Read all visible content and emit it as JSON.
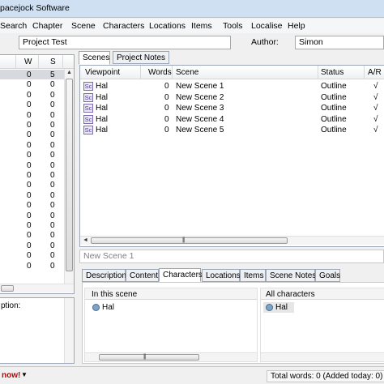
{
  "window": {
    "title": "pacejock Software"
  },
  "menu": [
    "Search",
    "Chapter",
    "Scene",
    "Characters",
    "Locations",
    "Items",
    "Tools",
    "Localise",
    "Help"
  ],
  "project": {
    "name": "Project Test",
    "author_label": "Author:",
    "author": "Simon"
  },
  "chapters": {
    "headers": [
      "W",
      "S"
    ],
    "rows": [
      {
        "w": "0",
        "s": "5"
      },
      {
        "w": "0",
        "s": "0"
      },
      {
        "w": "0",
        "s": "0"
      },
      {
        "w": "0",
        "s": "0"
      },
      {
        "w": "0",
        "s": "0"
      },
      {
        "w": "0",
        "s": "0"
      },
      {
        "w": "0",
        "s": "0"
      },
      {
        "w": "0",
        "s": "0"
      },
      {
        "w": "0",
        "s": "0"
      },
      {
        "w": "0",
        "s": "0"
      },
      {
        "w": "0",
        "s": "0"
      },
      {
        "w": "0",
        "s": "0"
      },
      {
        "w": "0",
        "s": "0"
      },
      {
        "w": "0",
        "s": "0"
      },
      {
        "w": "0",
        "s": "0"
      },
      {
        "w": "0",
        "s": "0"
      },
      {
        "w": "0",
        "s": "0"
      },
      {
        "w": "0",
        "s": "0"
      },
      {
        "w": "0",
        "s": "0"
      },
      {
        "w": "0",
        "s": "0"
      }
    ]
  },
  "description_label": "ption:",
  "scene_tabs": [
    "Scenes",
    "Project Notes"
  ],
  "scenes": {
    "headers": [
      "Viewpoint",
      "Words",
      "Scene",
      "Status",
      "A/R"
    ],
    "icon_text": "Sc",
    "rows": [
      {
        "viewpoint": "Hal",
        "words": "0",
        "scene": "New Scene 1",
        "status": "Outline",
        "ar": "√"
      },
      {
        "viewpoint": "Hal",
        "words": "0",
        "scene": "New Scene 2",
        "status": "Outline",
        "ar": "√"
      },
      {
        "viewpoint": "Hal",
        "words": "0",
        "scene": "New Scene 3",
        "status": "Outline",
        "ar": "√"
      },
      {
        "viewpoint": "Hal",
        "words": "0",
        "scene": "New Scene 4",
        "status": "Outline",
        "ar": "√"
      },
      {
        "viewpoint": "Hal",
        "words": "0",
        "scene": "New Scene 5",
        "status": "Outline",
        "ar": "√"
      }
    ]
  },
  "selected_scene": "New Scene 1",
  "detail_tabs": [
    "Description",
    "Content",
    "Characters",
    "Locations",
    "Items",
    "Scene Notes",
    "Goals"
  ],
  "characters_panel": {
    "in_scene_label": "In this scene",
    "in_scene": [
      "Hal"
    ],
    "all_label": "All characters",
    "all": [
      "Hal"
    ]
  },
  "status": {
    "left": "now!",
    "right": "Total words: 0 (Added today: 0)"
  },
  "colors": {
    "status_left": "#c00000",
    "selection": "#d6d9de"
  }
}
